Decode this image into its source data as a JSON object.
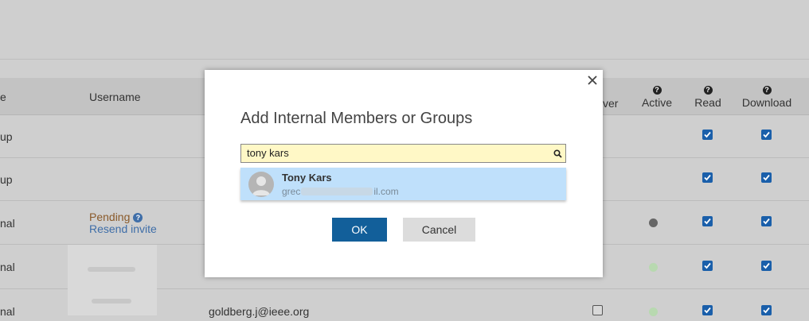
{
  "table": {
    "headers": {
      "name_partial": "e",
      "username": "Username",
      "approver_partial": "ver",
      "active": "Active",
      "read": "Read",
      "download": "Download"
    },
    "help_glyph": "?",
    "rows": [
      {
        "name_partial": "up"
      },
      {
        "name_partial": "up"
      },
      {
        "name_partial": "nal",
        "status": "Pending",
        "resend": "Resend invite",
        "active_color": "#666666"
      },
      {
        "name_partial": "nal",
        "active_color": "#b8d9b0"
      },
      {
        "name_partial": "nal",
        "email": "goldberg.j@ieee.org",
        "active_color": "#b8d9b0"
      }
    ]
  },
  "modal": {
    "title": "Add Internal Members or Groups",
    "search_value": "tony kars",
    "suggestion": {
      "name": "Tony Kars",
      "email_prefix": "grec",
      "email_suffix": "il.com"
    },
    "ok_label": "OK",
    "cancel_label": "Cancel"
  },
  "colors": {
    "primary": "#125f9a",
    "checkbox": "#1a5faa",
    "suggestion_bg": "#bfe0fb",
    "search_bg": "#fff8c6"
  }
}
